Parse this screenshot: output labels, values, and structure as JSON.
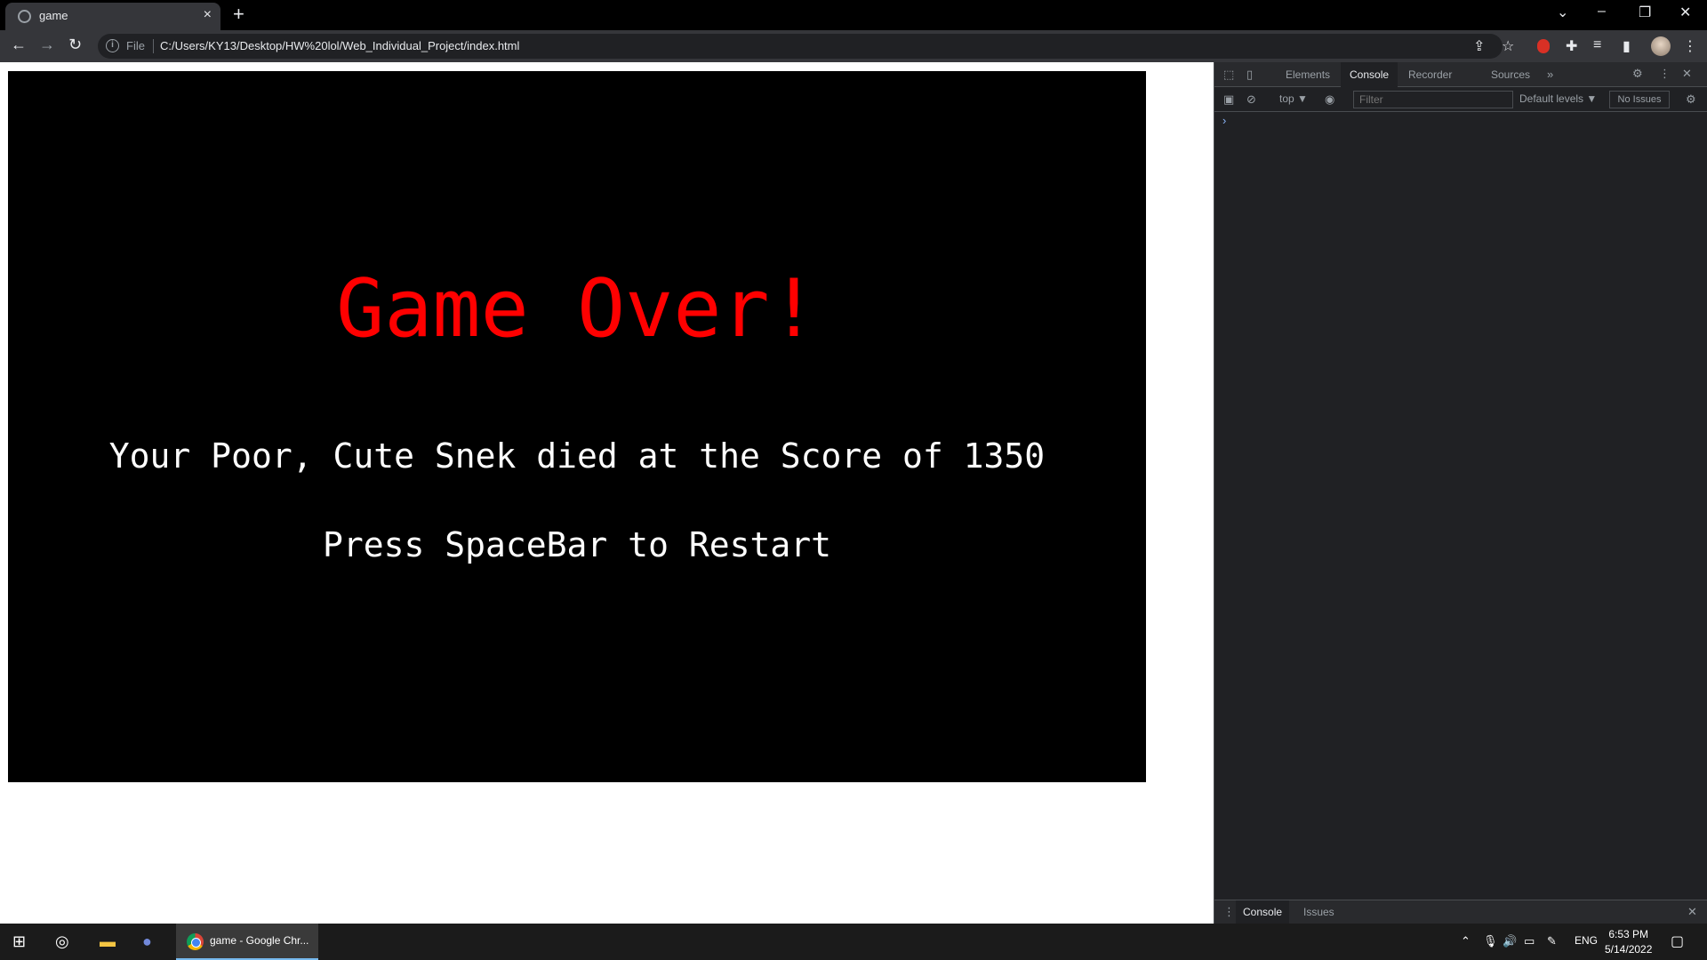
{
  "browser": {
    "tab_title": "game",
    "new_tab": "+",
    "url_scheme": "File",
    "url": "C:/Users/KY13/Desktop/HW%20lol/Web_Individual_Project/index.html"
  },
  "game": {
    "title": "Game Over!",
    "score_line": "Your Poor, Cute Snek died at the Score of 1350",
    "restart_line": "Press SpaceBar to Restart",
    "title_color": "#ff0000"
  },
  "devtools": {
    "tabs": [
      "Elements",
      "Console",
      "Recorder",
      "Sources"
    ],
    "context": "top ▼",
    "filter_placeholder": "Filter",
    "levels": "Default levels ▼",
    "issues": "No Issues",
    "prompt": "›",
    "drawer_tabs": [
      "Console",
      "Issues"
    ]
  },
  "taskbar": {
    "app_label": "game - Google Chr...",
    "language": "ENG",
    "time": "6:53 PM",
    "date": "5/14/2022"
  }
}
